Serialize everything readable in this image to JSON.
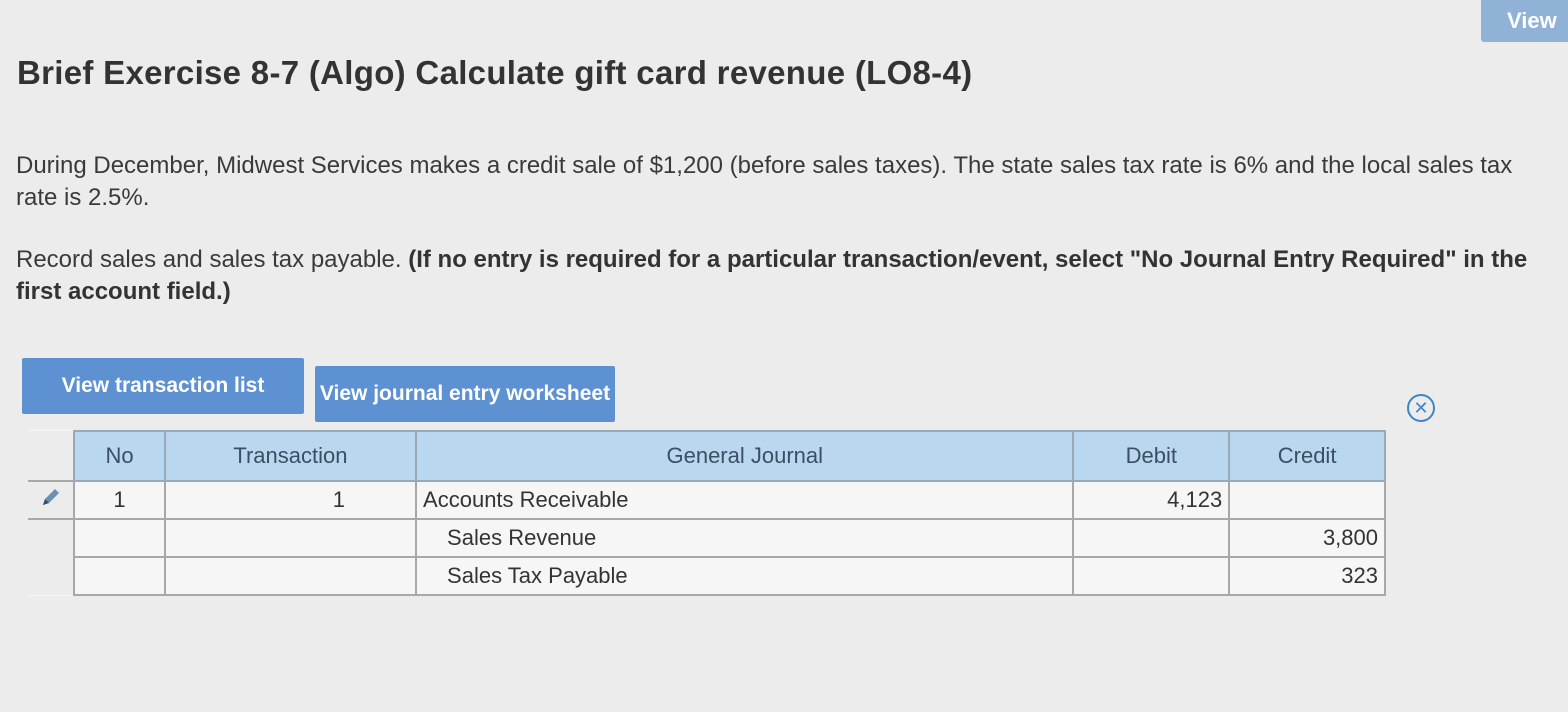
{
  "header": {
    "view_button_label": "View"
  },
  "title": "Brief Exercise 8-7 (Algo) Calculate gift card revenue (LO8-4)",
  "problem_text": "During December, Midwest Services makes a credit sale of $1,200 (before sales taxes). The state sales tax rate is 6% and the local sales tax rate is 2.5%.",
  "instruction_plain": "Record sales and sales tax payable. ",
  "instruction_bold": "(If no entry is required for a particular transaction/event, select \"No Journal Entry Required\" in the first account field.)",
  "buttons": {
    "view_transaction_list": "View transaction list",
    "view_journal_entry_worksheet": "View journal entry worksheet"
  },
  "table": {
    "headers": [
      "No",
      "Transaction",
      "General Journal",
      "Debit",
      "Credit"
    ],
    "rows": [
      {
        "no": "1",
        "transaction": "1",
        "account": "Accounts Receivable",
        "debit": "4,123",
        "credit": ""
      },
      {
        "no": "",
        "transaction": "",
        "account": "Sales Revenue",
        "debit": "",
        "credit": "3,800"
      },
      {
        "no": "",
        "transaction": "",
        "account": "Sales Tax Payable",
        "debit": "",
        "credit": "323"
      }
    ]
  },
  "icons": {
    "close": "close-icon",
    "edit": "pencil-icon"
  },
  "colors": {
    "button_blue": "#5d91d1",
    "header_blue": "#b9d8ef",
    "close_blue": "#3e86c8"
  }
}
